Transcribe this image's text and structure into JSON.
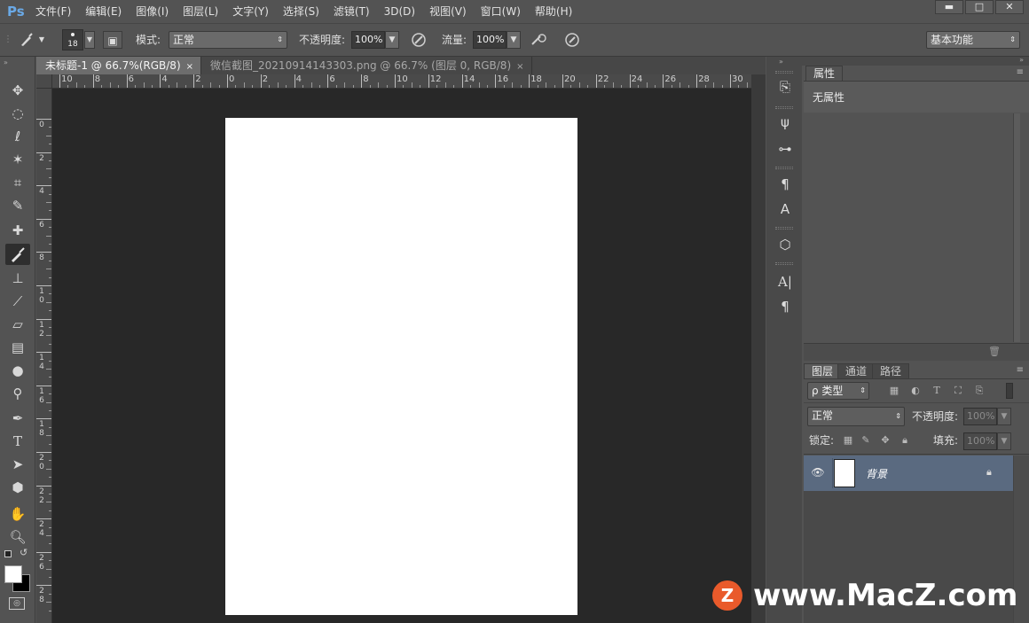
{
  "app": {
    "logo": "Ps"
  },
  "menu": [
    "文件(F)",
    "编辑(E)",
    "图像(I)",
    "图层(L)",
    "文字(Y)",
    "选择(S)",
    "滤镜(T)",
    "3D(D)",
    "视图(V)",
    "窗口(W)",
    "帮助(H)"
  ],
  "window_controls": {
    "minimize": "▬",
    "maximize": "□",
    "close": "✕"
  },
  "options": {
    "brush_size": "18",
    "mode_label": "模式:",
    "mode_value": "正常",
    "opacity_label": "不透明度:",
    "opacity_value": "100%",
    "flow_label": "流量:",
    "flow_value": "100%",
    "workspace": "基本功能"
  },
  "tabs": [
    {
      "label": "未标题-1 @ 66.7%(RGB/8)",
      "close": "×",
      "active": true
    },
    {
      "label": "微信截图_20210914143303.png @ 66.7% (图层 0, RGB/8)",
      "close": "×",
      "active": false
    }
  ],
  "ruler": {
    "top": [
      "10",
      "8",
      "6",
      "4",
      "2",
      "0",
      "2",
      "4",
      "6",
      "8",
      "10",
      "12",
      "14",
      "16",
      "18",
      "20",
      "22",
      "24",
      "26",
      "28",
      "30"
    ],
    "left": [
      "0",
      "2",
      "4",
      "6",
      "8",
      "10",
      "12",
      "14",
      "16",
      "18",
      "20",
      "22",
      "24",
      "26",
      "28"
    ]
  },
  "properties": {
    "tab": "属性",
    "empty_text": "无属性"
  },
  "layers": {
    "tabs": [
      "图层",
      "通道",
      "路径"
    ],
    "filter_label": "ρ 类型",
    "blend_mode": "正常",
    "opacity_label": "不透明度:",
    "opacity_value": "100%",
    "lock_label": "锁定:",
    "fill_label": "填充:",
    "fill_value": "100%",
    "items": [
      {
        "name": "背景",
        "locked": true
      }
    ]
  },
  "watermark": {
    "logo": "Z",
    "text": "www.MacZ.com"
  },
  "colors": {
    "accent": "#6aa9e6",
    "layer_selected": "#5a6a80",
    "watermark": "#e95a2b"
  }
}
